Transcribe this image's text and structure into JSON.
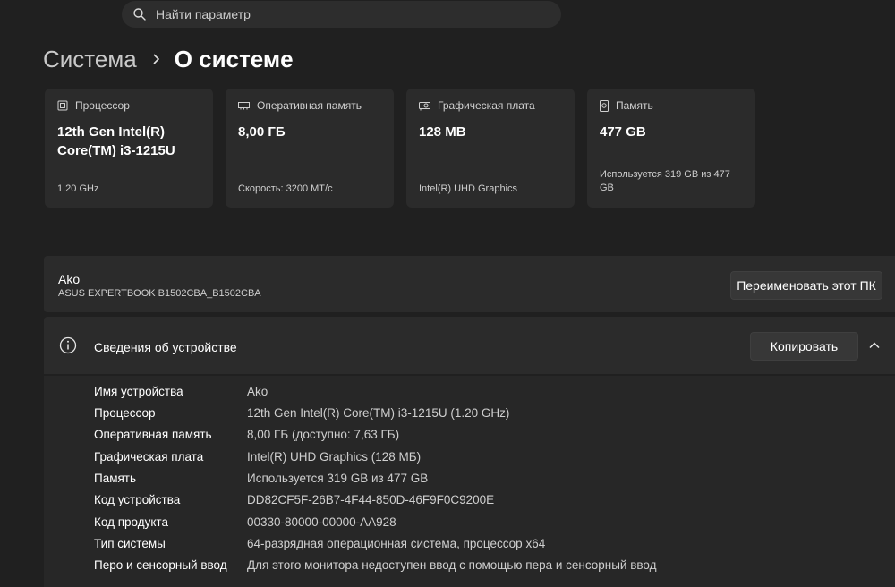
{
  "search": {
    "placeholder": "Найти параметр",
    "icon": "search-icon"
  },
  "breadcrumb": {
    "parent": "Система",
    "current": "О системе"
  },
  "cards": [
    {
      "icon": "processor-icon",
      "label": "Процессор",
      "value": "12th Gen Intel(R) Core(TM) i3-1215U",
      "sub": "1.20 GHz"
    },
    {
      "icon": "memory-icon",
      "label": "Оперативная память",
      "value": "8,00 ГБ",
      "sub": "Скорость: 3200 MT/с"
    },
    {
      "icon": "gpu-icon",
      "label": "Графическая плата",
      "value": "128 MB",
      "sub": "Intel(R) UHD Graphics"
    },
    {
      "icon": "storage-icon",
      "label": "Память",
      "value": "477 GB",
      "sub": "Используется 319 GB из 477 GB"
    }
  ],
  "pc": {
    "name": "Ako",
    "model": "ASUS EXPERTBOOK B1502CBA_B1502CBA",
    "rename_label": "Переименовать этот ПК"
  },
  "details": {
    "title": "Сведения об устройстве",
    "copy_label": "Копировать",
    "rows": [
      {
        "key": "Имя устройства",
        "value": "Ako"
      },
      {
        "key": "Процессор",
        "value": "12th Gen Intel(R) Core(TM) i3-1215U (1.20 GHz)"
      },
      {
        "key": "Оперативная память",
        "value": "8,00 ГБ (доступно: 7,63 ГБ)"
      },
      {
        "key": "Графическая плата",
        "value": "Intel(R) UHD Graphics (128 МБ)"
      },
      {
        "key": "Память",
        "value": "Используется 319 GB из 477 GB"
      },
      {
        "key": "Код устройства",
        "value": "DD82CF5F-26B7-4F44-850D-46F9F0C9200E"
      },
      {
        "key": "Код продукта",
        "value": "00330-80000-00000-AA928"
      },
      {
        "key": "Тип системы",
        "value": "64-разрядная операционная система, процессор x64"
      },
      {
        "key": "Перо и сенсорный ввод",
        "value": "Для этого монитора недоступен ввод с помощью пера и сенсорный ввод"
      }
    ]
  }
}
